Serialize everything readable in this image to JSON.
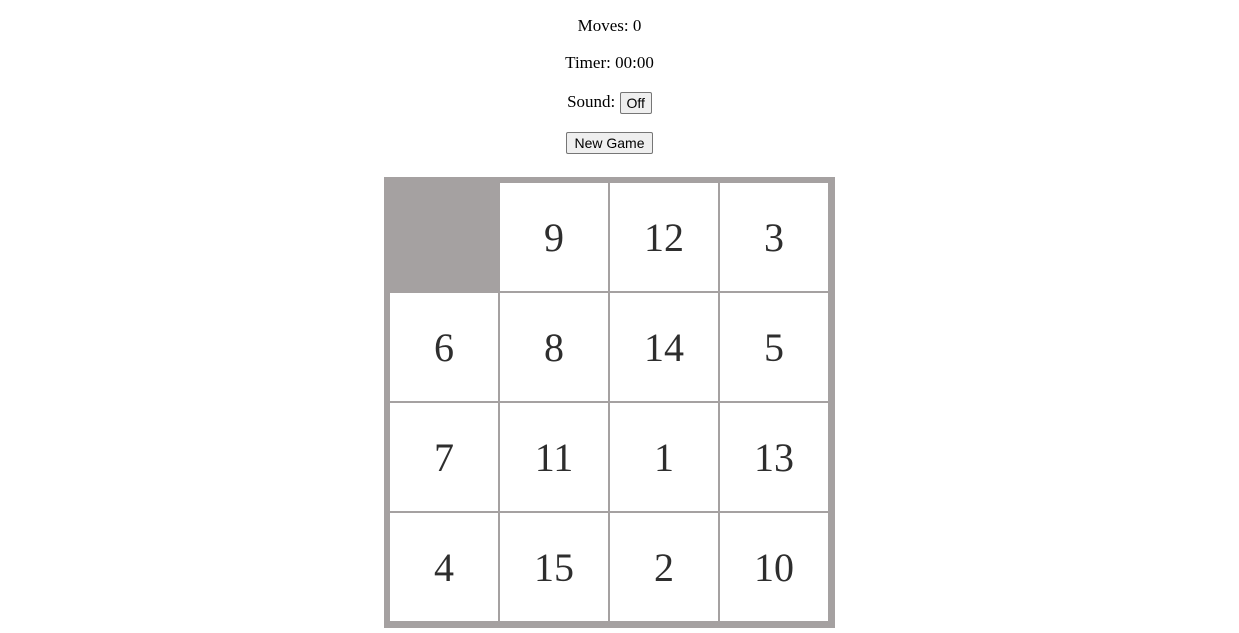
{
  "stats": {
    "moves_label": "Moves:",
    "moves_value": "0",
    "timer_label": "Timer:",
    "timer_value": "00:00",
    "sound_label": "Sound:",
    "sound_button": "Off"
  },
  "controls": {
    "new_game_label": "New Game"
  },
  "board": {
    "rows": 4,
    "cols": 4,
    "tiles": [
      [
        "",
        "9",
        "12",
        "3"
      ],
      [
        "6",
        "8",
        "14",
        "5"
      ],
      [
        "7",
        "11",
        "1",
        "13"
      ],
      [
        "4",
        "15",
        "2",
        "10"
      ]
    ]
  },
  "colors": {
    "board_background": "#a5a1a1",
    "tile_background": "#ffffff",
    "tile_text": "#2e2e2e"
  }
}
